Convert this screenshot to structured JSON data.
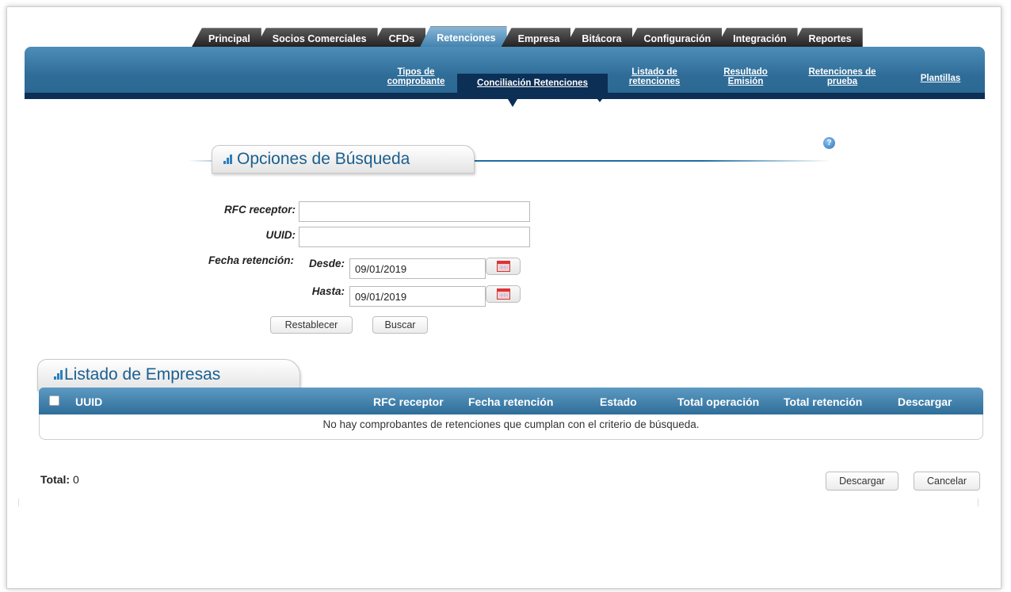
{
  "tabs": [
    {
      "label": "Principal"
    },
    {
      "label": "Socios Comerciales"
    },
    {
      "label": "CFDs"
    },
    {
      "label": "Retenciones",
      "active": true
    },
    {
      "label": "Empresa"
    },
    {
      "label": "Bitácora"
    },
    {
      "label": "Configuración"
    },
    {
      "label": "Integración"
    },
    {
      "label": "Reportes"
    }
  ],
  "subnav": {
    "tipos": "Tipos de comprobante",
    "conciliacion": "Conciliación  Retenciones",
    "listado": "Listado de retenciones",
    "resultado": "Resultado Emisión",
    "prueba": "Retenciones de prueba",
    "plantillas": "Plantillas"
  },
  "search": {
    "title": "Opciones de Búsqueda",
    "rfc_label": "RFC receptor:",
    "rfc_value": "",
    "uuid_label": "UUID:",
    "uuid_value": "",
    "fecha_label": "Fecha retención:",
    "desde_label": "Desde:",
    "desde_value": "09/01/2019",
    "hasta_label": "Hasta:",
    "hasta_value": "09/01/2019",
    "reset_button": "Restablecer",
    "search_button": "Buscar"
  },
  "list": {
    "title": "Listado de Empresas",
    "columns": {
      "uuid": "UUID",
      "rfc": "RFC receptor",
      "fecha": "Fecha retención",
      "estado": "Estado",
      "total_op": "Total operación",
      "total_ret": "Total retención",
      "descargar": "Descargar"
    },
    "empty_message": "No hay comprobantes de retenciones que cumplan con el criterio de búsqueda."
  },
  "footer": {
    "total_label": "Total:",
    "total_value": "0",
    "download_button": "Descargar",
    "cancel_button": "Cancelar"
  },
  "icons": {
    "help": "help-icon",
    "calendar": "calendar-icon",
    "section": "bars-icon"
  },
  "colors": {
    "accent_blue": "#2f6d98",
    "dark_navy": "#0b2f55",
    "section_title": "#1b5f8f"
  }
}
